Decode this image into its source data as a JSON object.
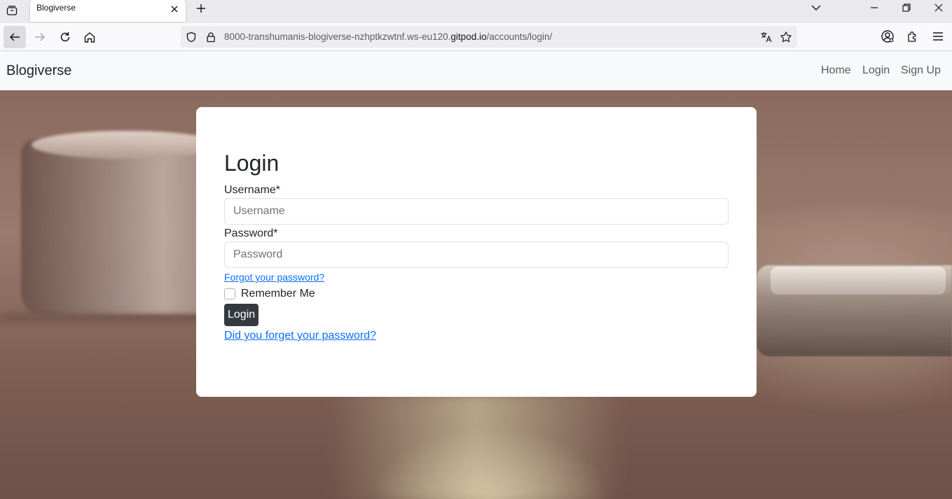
{
  "browser": {
    "tab_title": "Blogiverse",
    "url_prefix": "8000-transhumanis-blogiverse-nzhptkzwtnf.ws-eu120.",
    "url_host": "gitpod.io",
    "url_path": "/accounts/login/"
  },
  "icons": {
    "tab_list": "tab-list-icon",
    "tab_close": "close-icon",
    "new_tab": "plus-icon",
    "back": "back-arrow-icon",
    "forward": "forward-arrow-icon",
    "reload": "reload-icon",
    "home": "home-icon",
    "shield": "shield-icon",
    "lock": "lock-icon",
    "translate": "translate-icon",
    "bookmark": "star-icon",
    "account": "account-icon",
    "extensions": "extensions-icon",
    "menu": "hamburger-menu-icon"
  },
  "site": {
    "brand": "Blogiverse",
    "nav": [
      "Home",
      "Login",
      "Sign Up"
    ]
  },
  "login": {
    "heading": "Login",
    "username_label": "Username*",
    "username_placeholder": "Username",
    "password_label": "Password*",
    "password_placeholder": "Password",
    "forgot_small": "Forgot your password?",
    "remember_label": "Remember Me",
    "submit_label": "Login",
    "forgot_big": "Did you forget your password?"
  },
  "colors": {
    "link": "#0d6efd",
    "button": "#343a40",
    "header_bg": "#f8f9fa"
  }
}
